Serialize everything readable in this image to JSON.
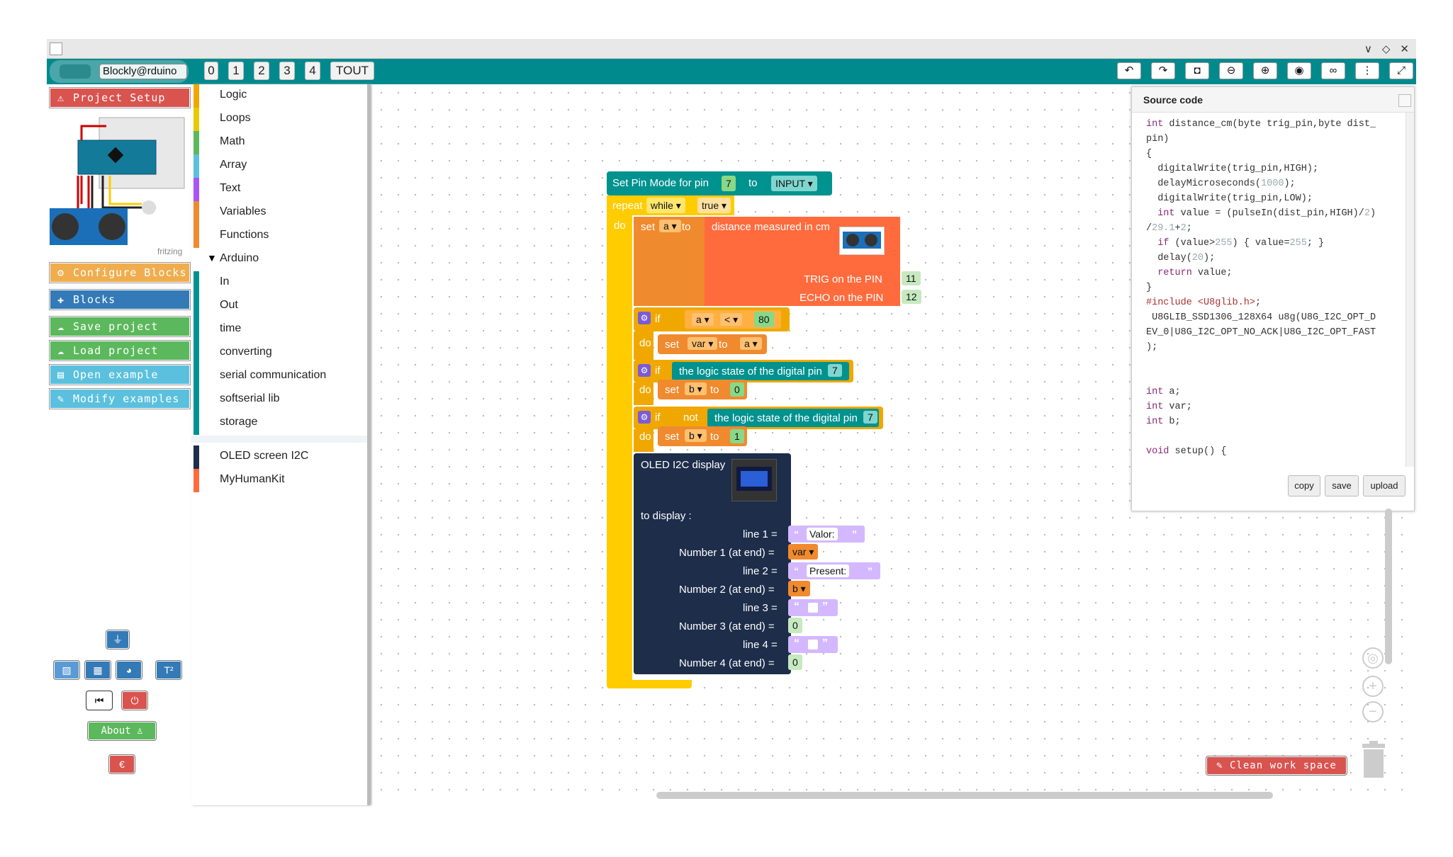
{
  "window": {
    "controls": [
      "∨",
      "◇",
      "✕"
    ]
  },
  "toolbar": {
    "tabs": [
      "0",
      "1",
      "2",
      "3",
      "4",
      "TOUT"
    ],
    "right_icons": [
      "undo-icon",
      "redo-icon",
      "camera-icon",
      "zoom-out-icon",
      "zoom-in-icon",
      "eye-icon",
      "glasses-icon",
      "more-icon",
      "fullscreen-icon"
    ],
    "right_glyphs": [
      "↶",
      "↷",
      "◘",
      "⊖",
      "⊕",
      "◉",
      "∞",
      "⋮",
      "⤢"
    ]
  },
  "logo": {
    "label": "Blockly@rduino"
  },
  "sidebar": {
    "buttons": [
      {
        "label": "Project Setup",
        "icon": "⚠"
      },
      {
        "label": "Configure Blocks",
        "icon": "⚙"
      },
      {
        "label": "Blocks",
        "icon": "✚"
      },
      {
        "label": "Save project",
        "icon": "☁"
      },
      {
        "label": "Load project",
        "icon": "☁"
      },
      {
        "label": "Open example",
        "icon": "▤"
      },
      {
        "label": "Modify examples",
        "icon": "✎"
      }
    ],
    "fritzing": "fritzing",
    "about": "About",
    "about_icon": "👤",
    "euro": "€"
  },
  "categories": [
    {
      "label": "Logic",
      "color": "#f0a800"
    },
    {
      "label": "Loops",
      "color": "#e8c800"
    },
    {
      "label": "Math",
      "color": "#5cb85c"
    },
    {
      "label": "Array",
      "color": "#5bc0de"
    },
    {
      "label": "Text",
      "color": "#a855f7"
    },
    {
      "label": "Variables",
      "color": "#f08a2e"
    },
    {
      "label": "Functions",
      "color": "#f08a2e"
    },
    {
      "label": "Arduino",
      "color": "#ffffff"
    },
    {
      "label": "In",
      "color": "#00928f"
    },
    {
      "label": "Out",
      "color": "#00928f"
    },
    {
      "label": "time",
      "color": "#00928f"
    },
    {
      "label": "converting",
      "color": "#00928f"
    },
    {
      "label": "serial communication",
      "color": "#00928f"
    },
    {
      "label": "softserial lib",
      "color": "#00928f"
    },
    {
      "label": "storage",
      "color": "#00928f"
    },
    {
      "label": "OLED screen I2C",
      "color": "#1d2d4a"
    },
    {
      "label": "MyHumanKit",
      "color": "#ff6b3d"
    }
  ],
  "blocks": {
    "pinmode": "Set Pin Mode for pin",
    "pin7": "7",
    "to": "to",
    "input": "INPUT ▾",
    "repeat": "repeat",
    "while": "while ▾",
    "true": "true ▾",
    "do": "do",
    "set": "set",
    "a": "a ▾",
    "distance": "distance measured in cm",
    "trig": "TRIG on the PIN",
    "trig_val": "11",
    "echo": "ECHO on the PIN",
    "echo_val": "12",
    "if": "if",
    "lt": "< ▾",
    "eighty": "80",
    "var": "var ▾",
    "b": "b ▾",
    "logic": "the logic state of the digital pin",
    "zero": "0",
    "not": "not",
    "one": "1",
    "oled": "OLED I2C display",
    "to_display": "to display :",
    "line1": "line 1 =",
    "num1": "Number 1 (at end) =",
    "line2": "line 2 =",
    "num2": "Number 2 (at end) =",
    "line3": "line 3 =",
    "num3": "Number 3 (at end) =",
    "line4": "line 4 =",
    "num4": "Number 4 (at end) =",
    "valor": "Valor:",
    "present": "Present:",
    "q_open": "“",
    "q_close": "”"
  },
  "source": {
    "title": "Source code",
    "copy": "copy",
    "save": "save",
    "upload": "upload"
  },
  "clean": {
    "label": "Clean work space",
    "icon": "✎"
  },
  "colors": {
    "teal": "#008a8e",
    "loop": "#ffcc00",
    "var": "#f08a2e",
    "sensor": "#ff6b3d",
    "oled": "#1d2d4a",
    "text": "#d4b8ff",
    "math": "#88d888"
  }
}
